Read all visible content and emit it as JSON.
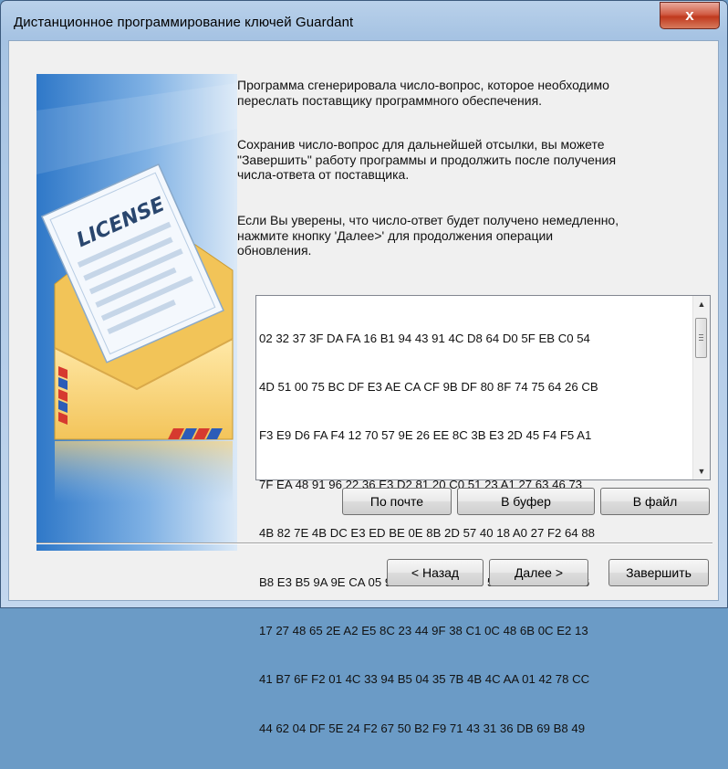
{
  "window": {
    "title": "Дистанционное программирование ключей Guardant",
    "close_label": "x"
  },
  "illustration": {
    "license_text": "LICENSE",
    "icon": "license-envelope-icon"
  },
  "message": {
    "p1": [
      "Программа сгенерировала число-вопрос, которое необходимо",
      "переслать поставщику программного обеспечения."
    ],
    "p2": [
      "Сохранив число-вопрос для дальнейшей отсылки, вы можете",
      "\"Завершить\" работу программы и продолжить после получения",
      "числа-ответа от поставщика."
    ],
    "p3": [
      "Если Вы уверены, что число-ответ будет получено немедленно,",
      "нажмите кнопку 'Далее>' для продолжения операции",
      "обновления."
    ]
  },
  "code_lines": [
    "02 32 37 3F DA FA 16 B1 94 43 91 4C D8 64 D0 5F EB C0 54",
    "4D 51 00 75 BC DF E3 AE CA CF 9B DF 80 8F 74 75 64 26 CB",
    "F3 E9 D6 FA F4 12 70 57 9E 26 EE 8C 3B E3 2D 45 F4 F5 A1",
    "7F EA 48 91 96 22 36 E3 D2 81 20 C0 51 23 A1 27 63 46 73",
    "4B 82 7E 4B DC E3 ED BE 0E 8B 2D 57 40 18 A0 27 F2 64 88",
    "B8 E3 B5 9A 9E CA 05 90 3A B2 68 01 13 58 EF 25 BD 91 76",
    "17 27 48 65 2E A2 E5 8C 23 44 9F 38 C1 0C 48 6B 0C E2 13",
    "41 B7 6F F2 01 4C 33 94 B5 04 35 7B 4B 4C AA 01 42 78 CC",
    "44 62 04 DF 5E 24 F2 67 50 B2 F9 71 43 31 36 DB 69 B8 49"
  ],
  "action_buttons": {
    "by_mail": "По почте",
    "to_clipboard": "В буфер",
    "to_file": "В файл"
  },
  "nav_buttons": {
    "back": "< Назад",
    "next": "Далее >",
    "finish": "Завершить"
  }
}
